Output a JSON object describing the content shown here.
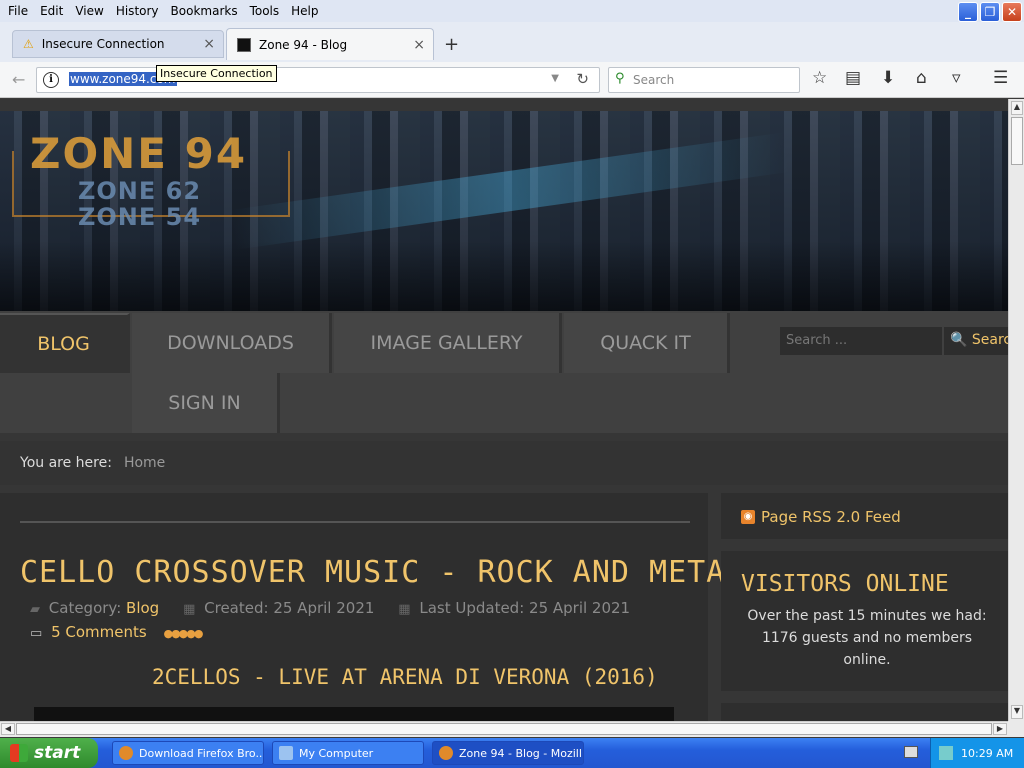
{
  "menubar": {
    "items": [
      "File",
      "Edit",
      "View",
      "History",
      "Bookmarks",
      "Tools",
      "Help"
    ]
  },
  "window": {
    "minimize": "_",
    "restore": "❐",
    "close": "✕"
  },
  "tabs": [
    {
      "title": "Insecure Connection",
      "close": "×",
      "warn": "⚠"
    },
    {
      "title": "Zone 94 - Blog",
      "close": "×"
    }
  ],
  "newtab": "+",
  "navbar": {
    "url": "www.zone94.com",
    "tooltip": "Insecure Connection",
    "search_placeholder": "Search",
    "back": "←",
    "reload": "↻",
    "dropmark": "▼",
    "bookmark": "☆",
    "library": "▤",
    "download": "⬇",
    "home": "⌂",
    "pocket": "▿",
    "menu": "☰"
  },
  "banner": {
    "logo": "ZONE 94",
    "sub1": "ZONE 62",
    "sub2": "ZONE 54"
  },
  "mainnav": {
    "items": [
      "BLOG",
      "DOWNLOADS",
      "IMAGE GALLERY",
      "QUACK IT",
      "SIGN IN"
    ],
    "search_placeholder": "Search ...",
    "search_button": "🔍 Search"
  },
  "breadcrumb": {
    "label": "You are here:",
    "home": "Home"
  },
  "article": {
    "title": "CELLO CROSSOVER MUSIC - ROCK AND METAL",
    "category_label": "Category:",
    "category": "Blog",
    "created": "Created: 25 April 2021",
    "updated": "Last Updated: 25 April 2021",
    "comments": "5 Comments",
    "rating": "●●●●●",
    "subtitle": "2CELLOS - LIVE AT ARENA DI VERONA (2016)"
  },
  "sidebar": {
    "rss": "Page RSS 2.0 Feed",
    "visitors_title": "VISITORS ONLINE",
    "visitors_text": "Over the past 15 minutes we had: 1176 guests and no members online."
  },
  "taskbar": {
    "start": "start",
    "tasks": [
      "Download Firefox Bro...",
      "My Computer",
      "Zone 94 - Blog - Mozill..."
    ],
    "clock": "10:29 AM"
  },
  "colors": {
    "accent": "#f0c46a",
    "page_bg": "#363636",
    "nav_bg": "#404040"
  }
}
